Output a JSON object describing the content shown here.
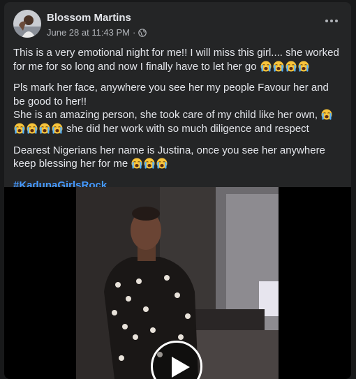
{
  "post": {
    "author": "Blossom Martins",
    "timestamp": "June 28 at 11:43 PM",
    "separator": "·",
    "privacy_icon": "globe-icon",
    "more_icon": "more-options-icon",
    "paragraphs": [
      "This is a very emotional night for me!! I will miss this girl.... she worked for me for so long and now I finally have to let her go",
      "Pls mark her face, anywhere you see her my people Favour her and be good to her!!",
      "She is an amazing person, she took care of my child like her own,",
      "she did her work with so much diligence and respect",
      "Dearest Nigerians her name is Justina, once you see her anywhere keep blessing her for me"
    ],
    "hashtag": "#KadunaGirlsRock",
    "emoji_icon": "loudly-crying-face-icon"
  },
  "video": {
    "play_icon": "play-icon"
  },
  "colors": {
    "background": "#18191a",
    "card": "#242526",
    "text_primary": "#e4e6eb",
    "text_secondary": "#b0b3b8",
    "link": "#4599ff"
  }
}
